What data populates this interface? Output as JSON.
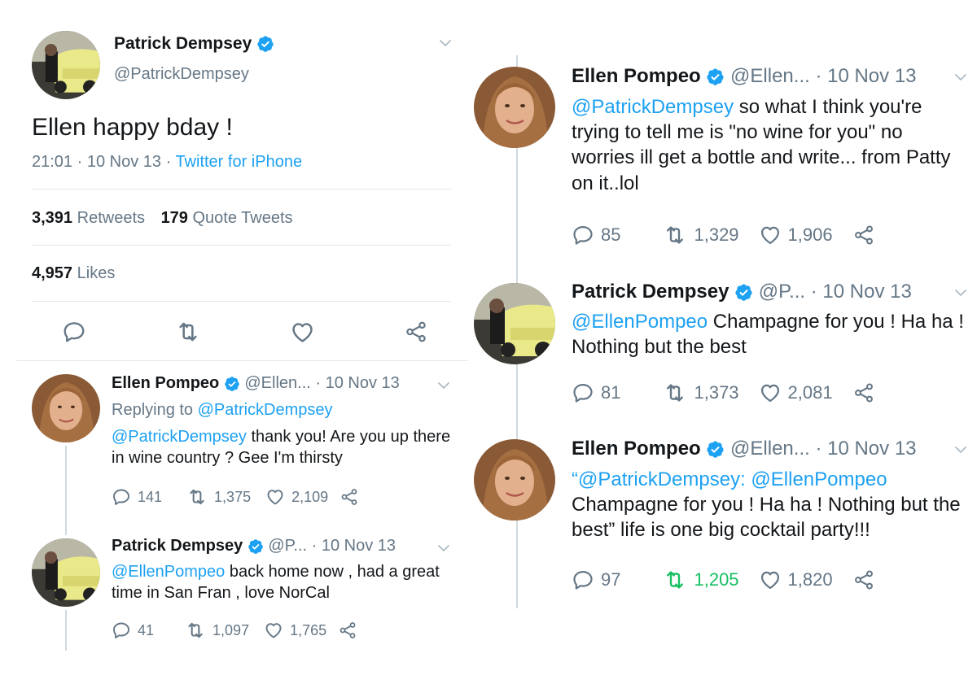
{
  "main_tweet": {
    "name": "Patrick Dempsey",
    "handle": "@PatrickDempsey",
    "text": "Ellen happy bday !",
    "time": "21:01",
    "sep1": " · ",
    "date": "10 Nov 13",
    "sep2": " · ",
    "source": "Twitter for iPhone",
    "retweets_count": "3,391",
    "retweets_label": "Retweets",
    "quotes_count": "179",
    "quotes_label": "Quote Tweets",
    "likes_count": "4,957",
    "likes_label": "Likes"
  },
  "left_replies": [
    {
      "name": "Ellen Pompeo",
      "handle": "@Ellen...",
      "date": "· 10 Nov 13",
      "replying_prefix": "Replying to ",
      "replying_to": "@PatrickDempsey",
      "mention": "@PatrickDempsey",
      "text": " thank you! Are you up there in wine country ? Gee I'm thirsty",
      "replies": "141",
      "retweets": "1,375",
      "likes": "2,109"
    },
    {
      "name": "Patrick Dempsey",
      "handle": "@P...",
      "date": "· 10 Nov 13",
      "mention": "@EllenPompeo",
      "text": " back home now , had a great time in  San Fran , love NorCal",
      "replies": "41",
      "retweets": "1,097",
      "likes": "1,765"
    }
  ],
  "right_tweets": [
    {
      "name": "Ellen Pompeo",
      "handle": "@Ellen...",
      "date": "· 10 Nov 13",
      "mention": "@PatrickDempsey",
      "text": " so what I think you're trying to tell me is \"no wine for you\" no worries ill get a bottle and write... from Patty on it..lol",
      "replies": "85",
      "retweets": "1,329",
      "likes": "1,906"
    },
    {
      "name": "Patrick Dempsey",
      "handle": "@P...",
      "date": "· 10 Nov 13",
      "mention": "@EllenPompeo",
      "text": " Champagne for you ! Ha ha ! Nothing but the best",
      "replies": "81",
      "retweets": "1,373",
      "likes": "2,081"
    },
    {
      "name": "Ellen Pompeo",
      "handle": "@Ellen...",
      "date": "· 10 Nov 13",
      "quote_open": "“",
      "mention": "@PatrickDempsey: @EllenPompeo",
      "text": " Champagne for you ! Ha ha ! Nothing but the best” life is one big cocktail party!!!",
      "replies": "97",
      "retweets": "1,205",
      "likes": "1,820"
    }
  ],
  "colors": {
    "accent": "#1da1f2",
    "muted": "#657786",
    "retweeted": "#17bf63",
    "divider": "#e1e8ed"
  }
}
